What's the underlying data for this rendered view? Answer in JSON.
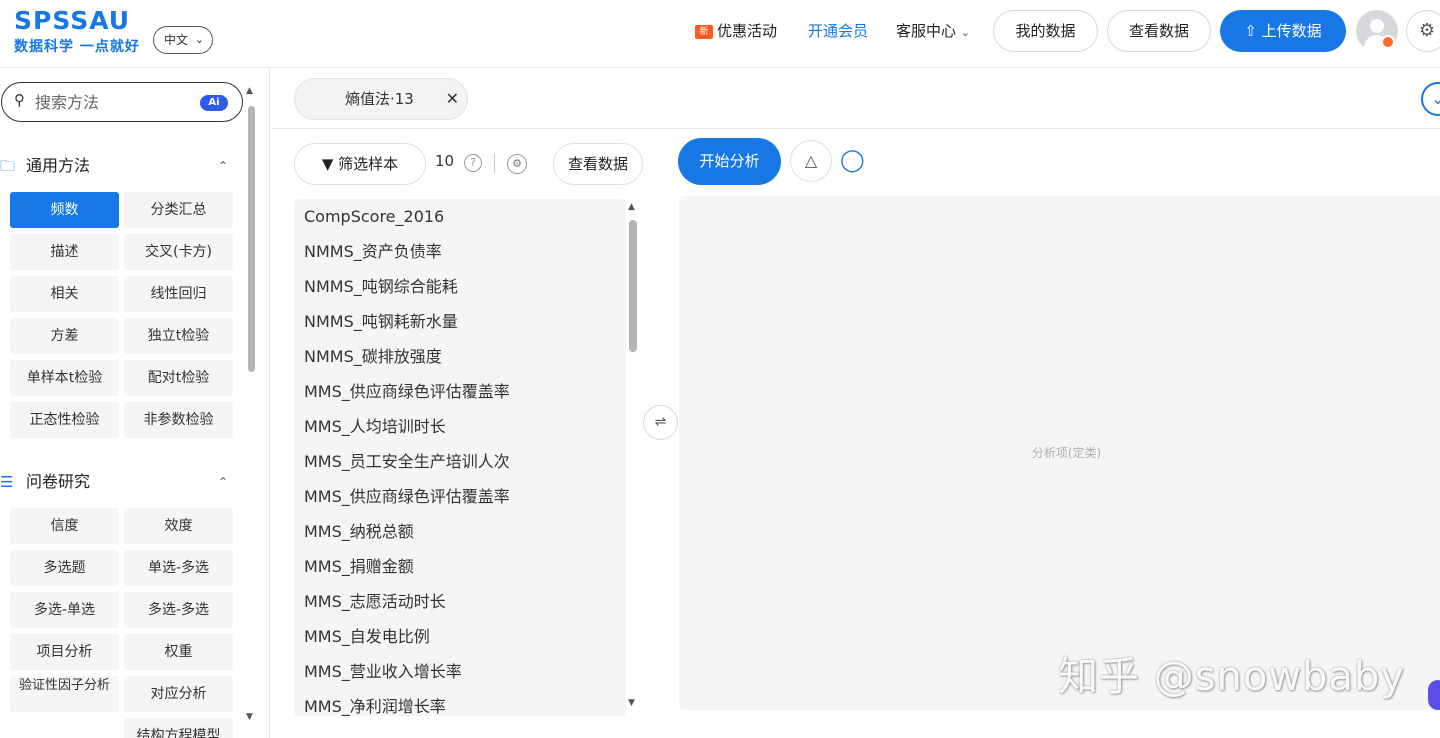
{
  "header": {
    "logo": "SPSSAU",
    "slogan": "数据科学 一点就好",
    "language": "中文",
    "promo_badge": "新",
    "promo": "优惠活动",
    "membership": "开通会员",
    "service": "客服中心",
    "my_data": "我的数据",
    "view_data": "查看数据",
    "upload": "上传数据"
  },
  "sidebar": {
    "search_placeholder": "搜索方法",
    "ai_label": "Ai",
    "sections": [
      {
        "title": "通用方法",
        "methods": [
          "频数",
          "分类汇总",
          "描述",
          "交叉(卡方)",
          "相关",
          "线性回归",
          "方差",
          "独立t检验",
          "单样本t检验",
          "配对t检验",
          "正态性检验",
          "非参数检验"
        ]
      },
      {
        "title": "问卷研究",
        "methods": [
          "信度",
          "效度",
          "多选题",
          "单选-多选",
          "多选-单选",
          "多选-多选",
          "项目分析",
          "权重",
          "验证性因子分析",
          "对应分析",
          "结构方程模型"
        ]
      }
    ]
  },
  "tab": {
    "label": "熵值法·13"
  },
  "toolbar": {
    "filter": "筛选样本",
    "sample_count": "10",
    "help": "?",
    "view_data": "查看数据",
    "start": "开始分析"
  },
  "variables": [
    "CompScore_2016",
    "NMMS_资产负债率",
    "NMMS_吨钢综合能耗",
    "NMMS_吨钢耗新水量",
    "NMMS_碳排放强度",
    "MMS_供应商绿色评估覆盖率",
    "MMS_人均培训时长",
    "MMS_员工安全生产培训人次",
    "MMS_供应商绿色评估覆盖率",
    "MMS_纳税总额",
    "MMS_捐赠金额",
    "MMS_志愿活动时长",
    "MMS_自发电比例",
    "MMS_营业收入增长率",
    "MMS_净利润增长率"
  ],
  "drop_area": {
    "label": "分析项(定类)"
  },
  "watermark": "知乎 @snowbaby",
  "colors": {
    "accent": "#1677e5",
    "panel": "#f5f5f5"
  }
}
